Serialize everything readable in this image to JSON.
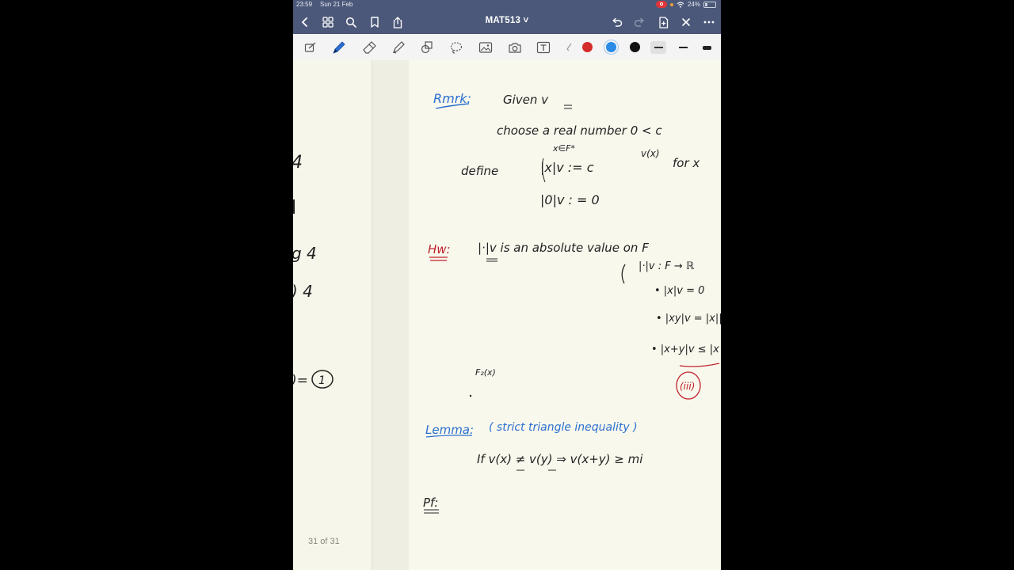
{
  "status_bar": {
    "time": "23:59",
    "date": "Sun 21 Feb",
    "battery": "24%"
  },
  "nav": {
    "document_title": "MAT513 ˅"
  },
  "toolbar": {
    "colors": [
      "#d42b2b",
      "#2a8be8",
      "#111111"
    ],
    "selected_color": "#2a8be8",
    "tools": [
      "shapes-icon",
      "pen-icon",
      "eraser-icon",
      "highlighter-icon",
      "shapes-tool-icon",
      "lasso-icon",
      "image-icon",
      "camera-icon",
      "text-box-icon",
      "laser-pointer-icon"
    ]
  },
  "page": {
    "indicator": "31 of 31"
  },
  "notes": {
    "rmrk_label": "Rmrk:",
    "given": "Given  v",
    "choose": "choose  a real  number  0 < c",
    "xef": "x∈F*",
    "define": "define",
    "abs_def": "|x|v  :=  c",
    "exponent": "v(x)",
    "for": "for   x",
    "zero_def": "|0|v : = 0",
    "hw_label": "Hw:",
    "hw_text": "|·|v    is  an  absolute  value  on  F",
    "cond_1": "|·|v : F → ℝ",
    "cond_2": "• |x|v = 0",
    "cond_3": "• |xy|v = |x||",
    "cond_4": "• |x+y|v ≤ |x",
    "iii": "(iii)",
    "fp": "F₂(x)",
    "lemma_label": "Lemma:",
    "lemma_title": "( strict  triangle  inequality )",
    "lemma_stmt": "If    v(x) ≠ v(y)    ⇒   v(x+y)  ≥ mi",
    "pf_label": "Pf:",
    "left_page_frag": ")= ",
    "left_circle": "1",
    "left_g": "g 4",
    "left_4a": "4",
    "left_4b": ") 4"
  }
}
